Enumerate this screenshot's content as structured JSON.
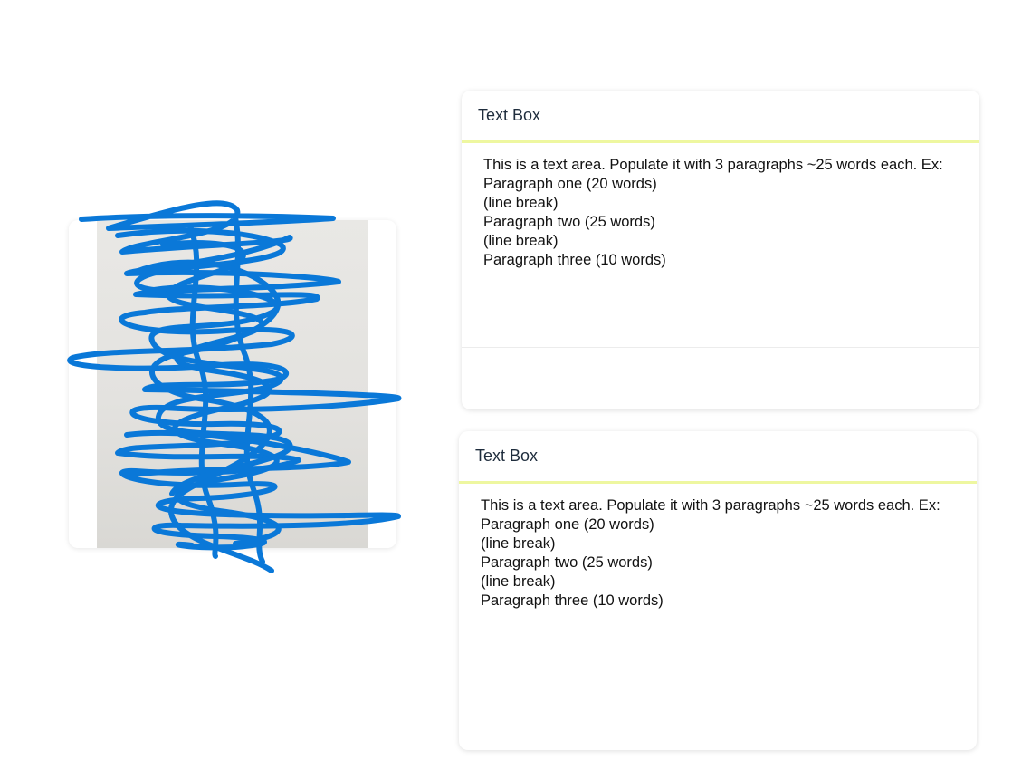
{
  "image_card": {
    "alt": "scribbled-out photo"
  },
  "text_boxes": [
    {
      "title": "Text Box",
      "body": "This is a text area. Populate it with 3 paragraphs ~25 words each. Ex:\nParagraph one (20 words)\n(line break)\nParagraph two (25 words)\n(line break)\nParagraph three (10 words)"
    },
    {
      "title": "Text Box",
      "body": "This is a text area. Populate it with 3 paragraphs ~25 words each. Ex:\nParagraph one (20 words)\n(line break)\nParagraph two (25 words)\n(line break)\nParagraph three (10 words)"
    }
  ],
  "colors": {
    "scribble": "#0a78d8",
    "header_underline": "#eef7a0"
  }
}
